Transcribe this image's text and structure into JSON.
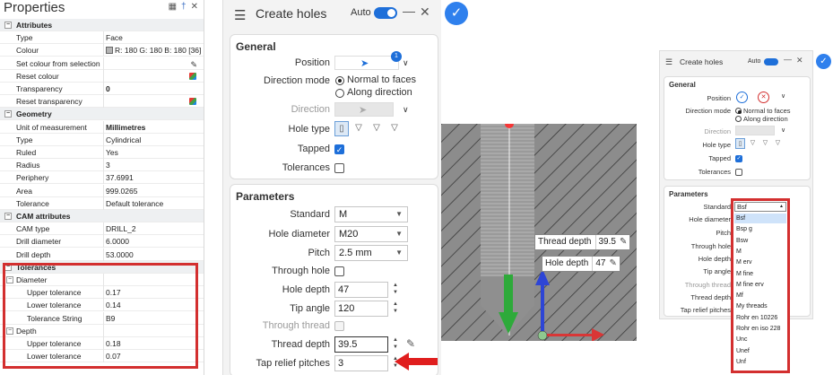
{
  "properties": {
    "title": "Properties",
    "rows": [
      {
        "kind": "section",
        "label": "Attributes"
      },
      {
        "kind": "row",
        "label": "Type",
        "value": "Face"
      },
      {
        "kind": "row",
        "label": "Colour",
        "value": "R: 180 G: 180 B: 180 [36]"
      },
      {
        "kind": "row",
        "label": "Set colour from selection",
        "value": ""
      },
      {
        "kind": "row",
        "label": "Reset colour",
        "value": ""
      },
      {
        "kind": "row",
        "label": "Transparency",
        "value": "0"
      },
      {
        "kind": "row",
        "label": "Reset transparency",
        "value": ""
      },
      {
        "kind": "section",
        "label": "Geometry"
      },
      {
        "kind": "row",
        "label": "Unit of measurement",
        "value": "Millimetres"
      },
      {
        "kind": "row",
        "label": "Type",
        "value": "Cylindrical"
      },
      {
        "kind": "row",
        "label": "Ruled",
        "value": "Yes"
      },
      {
        "kind": "row",
        "label": "Radius",
        "value": "3"
      },
      {
        "kind": "row",
        "label": "Periphery",
        "value": "37.6991"
      },
      {
        "kind": "row",
        "label": "Area",
        "value": "999.0265"
      },
      {
        "kind": "row",
        "label": "Tolerance",
        "value": "Default tolerance"
      },
      {
        "kind": "section",
        "label": "CAM attributes"
      },
      {
        "kind": "row",
        "label": "CAM type",
        "value": "DRILL_2"
      },
      {
        "kind": "row",
        "label": "Drill diameter",
        "value": "6.0000"
      },
      {
        "kind": "row",
        "label": "Drill depth",
        "value": "53.0000"
      },
      {
        "kind": "section",
        "label": "Tolerances"
      },
      {
        "kind": "sub",
        "label": "Diameter",
        "value": ""
      },
      {
        "kind": "irow",
        "label": "Upper tolerance",
        "value": "0.17"
      },
      {
        "kind": "irow",
        "label": "Lower tolerance",
        "value": "0.14"
      },
      {
        "kind": "irow",
        "label": "Tolerance String",
        "value": "B9"
      },
      {
        "kind": "sub",
        "label": "Depth",
        "value": ""
      },
      {
        "kind": "irow",
        "label": "Upper tolerance",
        "value": "0.18"
      },
      {
        "kind": "irow",
        "label": "Lower tolerance",
        "value": "0.07"
      }
    ]
  },
  "dialog": {
    "title": "Create holes",
    "auto_label": "Auto",
    "general": {
      "title": "General",
      "position_label": "Position",
      "position_badge": "1",
      "direction_mode_label": "Direction mode",
      "direction_mode_options": [
        "Normal to faces",
        "Along direction"
      ],
      "direction_label": "Direction",
      "hole_type_label": "Hole type",
      "tapped_label": "Tapped",
      "tolerances_label": "Tolerances"
    },
    "parameters": {
      "title": "Parameters",
      "standard_label": "Standard",
      "standard_value": "M",
      "hole_diameter_label": "Hole diameter",
      "hole_diameter_value": "M20",
      "pitch_label": "Pitch",
      "pitch_value": "2.5 mm",
      "through_hole_label": "Through hole",
      "hole_depth_label": "Hole depth",
      "hole_depth_value": "47",
      "tip_angle_label": "Tip angle",
      "tip_angle_value": "120",
      "through_thread_label": "Through thread",
      "thread_depth_label": "Thread depth",
      "thread_depth_value": "39.5",
      "tap_relief_label": "Tap relief pitches",
      "tap_relief_value": "3"
    }
  },
  "viewport": {
    "thread_depth_label": "Thread depth",
    "thread_depth_value": "39.5",
    "hole_depth_label": "Hole depth",
    "hole_depth_value": "47"
  },
  "small_dialog": {
    "title": "Create holes",
    "auto_label": "Auto",
    "general_title": "General",
    "position_label": "Position",
    "direction_mode_label": "Direction mode",
    "direction_mode_options": [
      "Normal to faces",
      "Along direction"
    ],
    "direction_label": "Direction",
    "hole_type_label": "Hole type",
    "tapped_label": "Tapped",
    "tolerances_label": "Tolerances",
    "parameters_title": "Parameters",
    "standard_label": "Standard",
    "hole_diameter_label": "Hole diameter",
    "pitch_label": "Pitch",
    "through_hole_label": "Through hole",
    "hole_depth_label": "Hole depth",
    "tip_angle_label": "Tip angle",
    "through_thread_label": "Through thread",
    "thread_depth_label": "Thread depth",
    "tap_relief_label": "Tap relief pitches",
    "standard_value": "Bsf",
    "standard_options": [
      "Bsf",
      "Bsp g",
      "Bsw",
      "M",
      "M erv",
      "M fine",
      "M fine erv",
      "Mf",
      "My threads",
      "Rohr en 10226",
      "Rohr en iso 228",
      "Unc",
      "Unef",
      "Unf"
    ],
    "highlighted_option": "Bsf"
  },
  "colors": {
    "accent": "#1e6fd9",
    "highlight_red": "#d32f2f",
    "axis_green": "#2eaa3a",
    "axis_blue": "#2d45d6",
    "axis_red": "#d93636"
  }
}
